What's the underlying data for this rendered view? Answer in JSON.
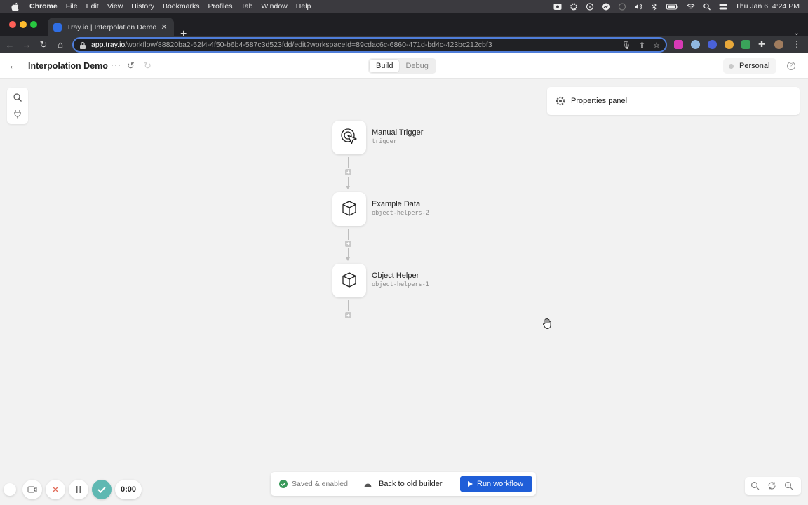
{
  "menubar": {
    "app": "Chrome",
    "items": [
      "File",
      "Edit",
      "View",
      "History",
      "Bookmarks",
      "Profiles",
      "Tab",
      "Window",
      "Help"
    ],
    "datetime": "Thu Jan 6  4:24 PM"
  },
  "browser": {
    "tab_title": "Tray.io | Interpolation Demo",
    "url_host": "app.tray.io",
    "url_path": "/workflow/88820ba2-52f4-4f50-b6b4-587c3d523fdd/edit?workspaceId=89cdac6c-6860-471d-bd4c-423bc212cbf3"
  },
  "header": {
    "title": "Interpolation Demo",
    "more_label": "···",
    "tabs": [
      "Build",
      "Debug"
    ],
    "active_tab": "Build",
    "workspace": "Personal"
  },
  "properties_panel": {
    "title": "Properties panel"
  },
  "nodes": [
    {
      "label": "Manual Trigger",
      "sub": "trigger",
      "icon": "cursor-click-icon"
    },
    {
      "label": "Example Data",
      "sub": "object-helpers-2",
      "icon": "cube-icon"
    },
    {
      "label": "Object Helper",
      "sub": "object-helpers-1",
      "icon": "cube-icon"
    }
  ],
  "recorder": {
    "timer": "0:00"
  },
  "bottombar": {
    "status": "Saved & enabled",
    "old_builder": "Back to old builder",
    "run": "Run workflow"
  },
  "colors": {
    "accent": "#1f5ed8",
    "success": "#3a9a5b",
    "recorder_check": "#5fb8b2"
  }
}
